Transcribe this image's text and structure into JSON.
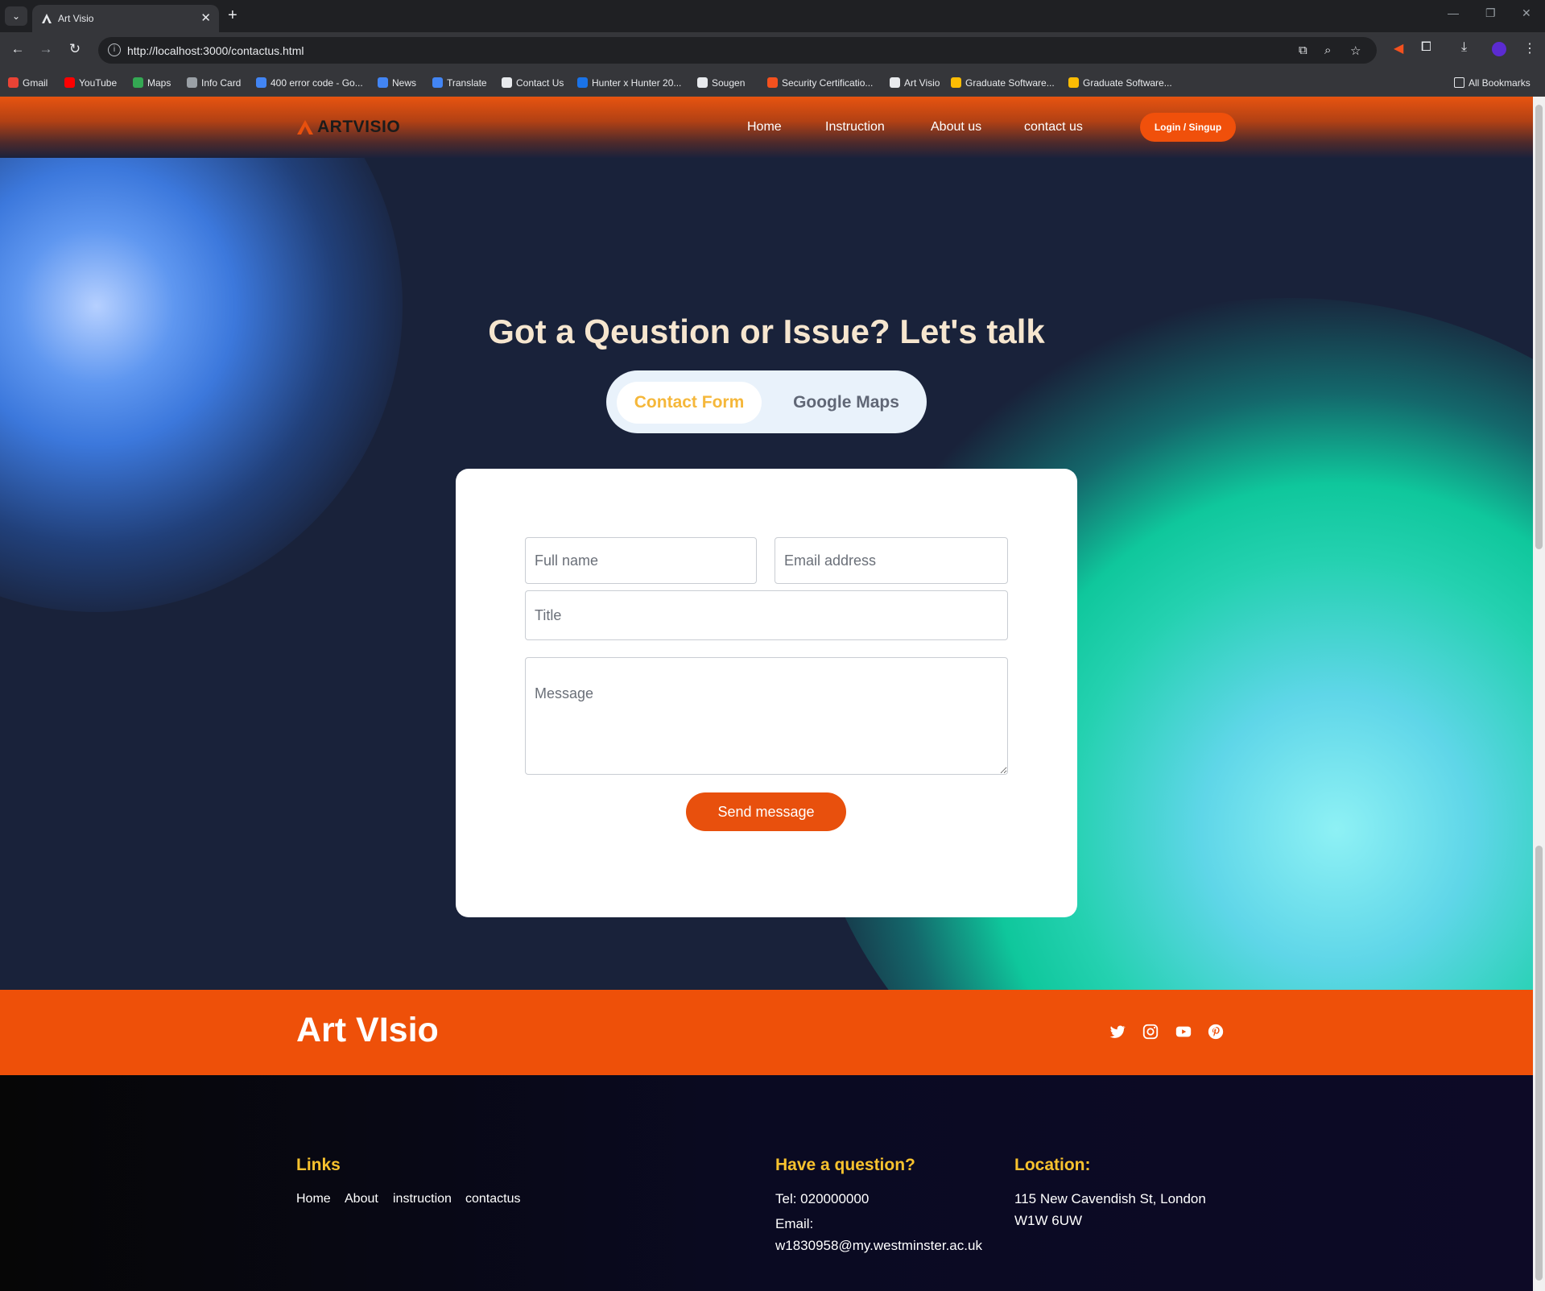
{
  "browser": {
    "tab_title": "Art Visio",
    "url": "http://localhost:3000/contactus.html",
    "bookmarks": [
      {
        "label": "Gmail",
        "color": "#ea4335"
      },
      {
        "label": "YouTube",
        "color": "#ff0000"
      },
      {
        "label": "Maps",
        "color": "#34a853"
      },
      {
        "label": "Info Card",
        "color": "#9aa0a6"
      },
      {
        "label": "400 error code - Go...",
        "color": "#4285f4"
      },
      {
        "label": "News",
        "color": "#4285f4"
      },
      {
        "label": "Translate",
        "color": "#4285f4"
      },
      {
        "label": "Contact Us",
        "color": "#e8eaed"
      },
      {
        "label": "Hunter x Hunter 20...",
        "color": "#1a73e8"
      },
      {
        "label": "Sougen",
        "color": "#e8eaed"
      },
      {
        "label": "Security Certificatio...",
        "color": "#f4511e"
      },
      {
        "label": "Art Visio",
        "color": "#e8eaed"
      },
      {
        "label": "Graduate Software...",
        "color": "#fbbc04"
      },
      {
        "label": "Graduate Software...",
        "color": "#fbbc04"
      }
    ],
    "all_bookmarks": "All Bookmarks"
  },
  "nav": {
    "logo": "ARTVISIO",
    "links": [
      "Home",
      "Instruction",
      "About us",
      "contact us"
    ],
    "login": "Login / Singup"
  },
  "hero": {
    "headline": "Got a Qeustion or Issue? Let's talk",
    "toggle": {
      "active": "Contact Form",
      "inactive": "Google Maps"
    }
  },
  "form": {
    "full_name_placeholder": "Full name",
    "email_placeholder": "Email address",
    "title_placeholder": "Title",
    "message_placeholder": "Message",
    "submit": "Send message"
  },
  "footer": {
    "brand": "Art VIsio",
    "social": [
      "twitter-icon",
      "instagram-icon",
      "youtube-icon",
      "pinterest-icon"
    ],
    "links_heading": "Links",
    "links": [
      "Home",
      "About",
      "instruction",
      "contactus"
    ],
    "question_heading": "Have a question?",
    "tel": "Tel: 020000000",
    "email_label": "Email:",
    "email": "w1830958@my.westminster.ac.uk",
    "location_heading": "Location:",
    "address_line1": "115 New Cavendish St, London",
    "address_line2": "W1W 6UW"
  },
  "colors": {
    "accent": "#ee5009",
    "headline": "#f6e6cf",
    "footer_heading": "#f8c22e",
    "toggle_active_text": "#f5b73a"
  }
}
